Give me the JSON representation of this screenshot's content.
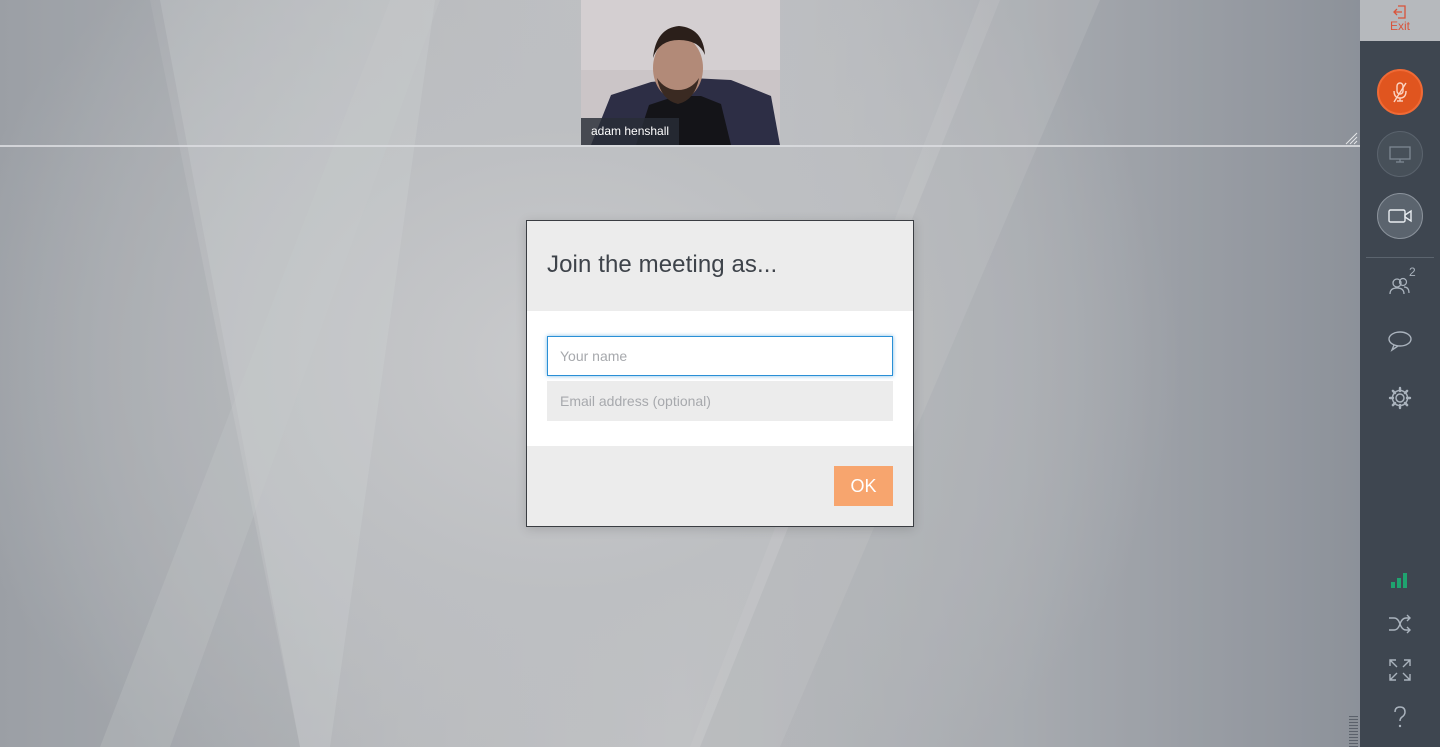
{
  "participant": {
    "name": "adam henshall"
  },
  "dialog": {
    "title": "Join the meeting as...",
    "name_placeholder": "Your name",
    "email_placeholder": "Email address (optional)",
    "ok_label": "OK"
  },
  "sidebar": {
    "exit_label": "Exit",
    "participants_count": "2",
    "mic_state": "muted",
    "connection_quality": "good"
  },
  "colors": {
    "accent_orange": "#f7a56e",
    "mic_muted": "#e0551f",
    "exit_red": "#d9533a",
    "sidebar_bg": "#3e4650",
    "focus_blue": "#2a8fd6",
    "signal_green": "#1fa36f"
  },
  "icons": [
    "exit-icon",
    "mic-muted-icon",
    "screen-share-icon",
    "camera-icon",
    "participants-icon",
    "chat-icon",
    "settings-icon",
    "signal-bars-icon",
    "shuffle-icon",
    "fullscreen-icon",
    "help-icon"
  ]
}
